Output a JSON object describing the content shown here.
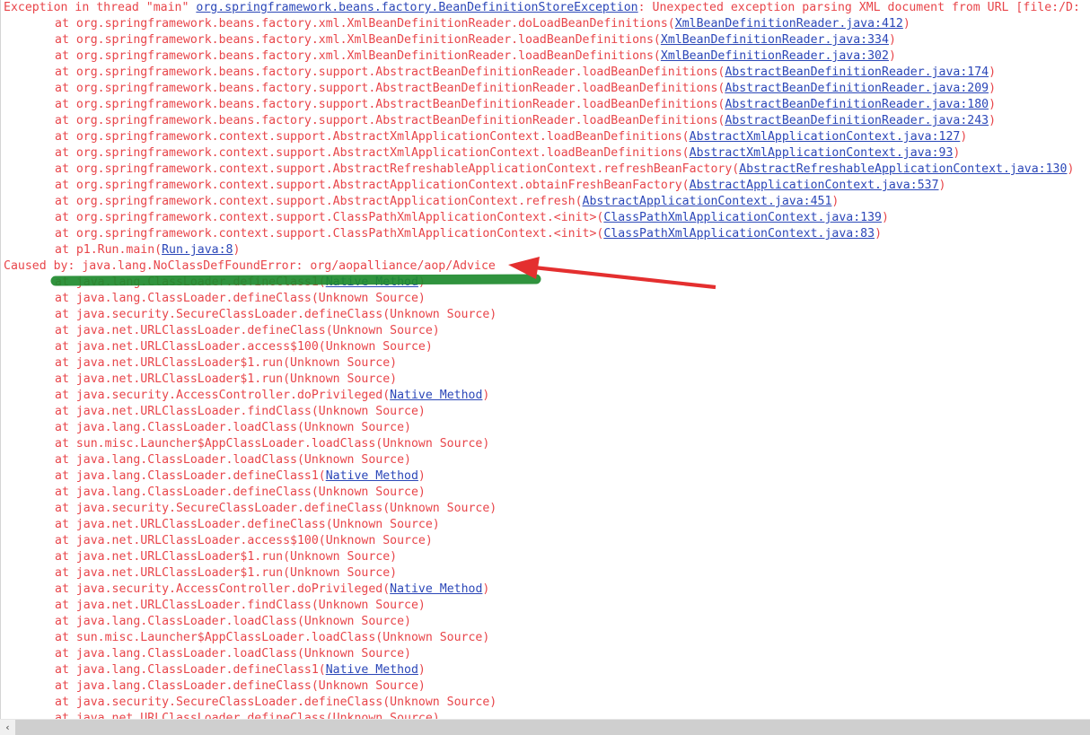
{
  "app": {
    "kind": "java-stacktrace-console",
    "colors": {
      "background": "#ffffff",
      "trace_text": "#e8454a",
      "hyperlink": "#2b47b8",
      "highlighter_green": "#1f8a2e",
      "arrow_red": "#e42f2f",
      "scrollbar_track": "#cfcfcf",
      "scrollbar_button": "#f0f0f0"
    }
  },
  "scrollbar": {
    "left_arrow_glyph": "‹",
    "orientation": "horizontal"
  },
  "annotations": {
    "highlighter": {
      "name": "green-highlighter-stroke",
      "color": "#1f8a2e",
      "target_text": "Caused by: java.lang.NoClassDefFoundError: org/aopalliance/aop/Advice"
    },
    "arrow": {
      "name": "red-arrow",
      "color": "#e42f2f",
      "points_to": "Caused by: java.lang.NoClassDefFoundError: org/aopalliance/aop/Advice"
    }
  },
  "trace": {
    "lines": [
      {
        "indent": false,
        "parts": [
          {
            "t": "Exception in thread \"main\" ",
            "link": false
          },
          {
            "t": "org.springframework.beans.factory.BeanDefinitionStoreException",
            "link": true
          },
          {
            "t": ": Unexpected exception parsing XML document from URL [file:/D:",
            "link": false
          }
        ]
      },
      {
        "indent": true,
        "parts": [
          {
            "t": "at org.springframework.beans.factory.xml.XmlBeanDefinitionReader.doLoadBeanDefinitions(",
            "link": false
          },
          {
            "t": "XmlBeanDefinitionReader.java:412",
            "link": true
          },
          {
            "t": ")",
            "link": false
          }
        ]
      },
      {
        "indent": true,
        "parts": [
          {
            "t": "at org.springframework.beans.factory.xml.XmlBeanDefinitionReader.loadBeanDefinitions(",
            "link": false
          },
          {
            "t": "XmlBeanDefinitionReader.java:334",
            "link": true
          },
          {
            "t": ")",
            "link": false
          }
        ]
      },
      {
        "indent": true,
        "parts": [
          {
            "t": "at org.springframework.beans.factory.xml.XmlBeanDefinitionReader.loadBeanDefinitions(",
            "link": false
          },
          {
            "t": "XmlBeanDefinitionReader.java:302",
            "link": true
          },
          {
            "t": ")",
            "link": false
          }
        ]
      },
      {
        "indent": true,
        "parts": [
          {
            "t": "at org.springframework.beans.factory.support.AbstractBeanDefinitionReader.loadBeanDefinitions(",
            "link": false
          },
          {
            "t": "AbstractBeanDefinitionReader.java:174",
            "link": true
          },
          {
            "t": ")",
            "link": false
          }
        ]
      },
      {
        "indent": true,
        "parts": [
          {
            "t": "at org.springframework.beans.factory.support.AbstractBeanDefinitionReader.loadBeanDefinitions(",
            "link": false
          },
          {
            "t": "AbstractBeanDefinitionReader.java:209",
            "link": true
          },
          {
            "t": ")",
            "link": false
          }
        ]
      },
      {
        "indent": true,
        "parts": [
          {
            "t": "at org.springframework.beans.factory.support.AbstractBeanDefinitionReader.loadBeanDefinitions(",
            "link": false
          },
          {
            "t": "AbstractBeanDefinitionReader.java:180",
            "link": true
          },
          {
            "t": ")",
            "link": false
          }
        ]
      },
      {
        "indent": true,
        "parts": [
          {
            "t": "at org.springframework.beans.factory.support.AbstractBeanDefinitionReader.loadBeanDefinitions(",
            "link": false
          },
          {
            "t": "AbstractBeanDefinitionReader.java:243",
            "link": true
          },
          {
            "t": ")",
            "link": false
          }
        ]
      },
      {
        "indent": true,
        "parts": [
          {
            "t": "at org.springframework.context.support.AbstractXmlApplicationContext.loadBeanDefinitions(",
            "link": false
          },
          {
            "t": "AbstractXmlApplicationContext.java:127",
            "link": true
          },
          {
            "t": ")",
            "link": false
          }
        ]
      },
      {
        "indent": true,
        "parts": [
          {
            "t": "at org.springframework.context.support.AbstractXmlApplicationContext.loadBeanDefinitions(",
            "link": false
          },
          {
            "t": "AbstractXmlApplicationContext.java:93",
            "link": true
          },
          {
            "t": ")",
            "link": false
          }
        ]
      },
      {
        "indent": true,
        "parts": [
          {
            "t": "at org.springframework.context.support.AbstractRefreshableApplicationContext.refreshBeanFactory(",
            "link": false
          },
          {
            "t": "AbstractRefreshableApplicationContext.java:130",
            "link": true
          },
          {
            "t": ")",
            "link": false
          }
        ]
      },
      {
        "indent": true,
        "parts": [
          {
            "t": "at org.springframework.context.support.AbstractApplicationContext.obtainFreshBeanFactory(",
            "link": false
          },
          {
            "t": "AbstractApplicationContext.java:537",
            "link": true
          },
          {
            "t": ")",
            "link": false
          }
        ]
      },
      {
        "indent": true,
        "parts": [
          {
            "t": "at org.springframework.context.support.AbstractApplicationContext.refresh(",
            "link": false
          },
          {
            "t": "AbstractApplicationContext.java:451",
            "link": true
          },
          {
            "t": ")",
            "link": false
          }
        ]
      },
      {
        "indent": true,
        "parts": [
          {
            "t": "at org.springframework.context.support.ClassPathXmlApplicationContext.<init>(",
            "link": false
          },
          {
            "t": "ClassPathXmlApplicationContext.java:139",
            "link": true
          },
          {
            "t": ")",
            "link": false
          }
        ]
      },
      {
        "indent": true,
        "parts": [
          {
            "t": "at org.springframework.context.support.ClassPathXmlApplicationContext.<init>(",
            "link": false
          },
          {
            "t": "ClassPathXmlApplicationContext.java:83",
            "link": true
          },
          {
            "t": ")",
            "link": false
          }
        ]
      },
      {
        "indent": true,
        "parts": [
          {
            "t": "at p1.Run.main(",
            "link": false
          },
          {
            "t": "Run.java:8",
            "link": true
          },
          {
            "t": ")",
            "link": false
          }
        ]
      },
      {
        "indent": false,
        "parts": [
          {
            "t": "Caused by: java.lang.NoClassDefFoundError: org/aopalliance/aop/Advice",
            "link": false
          }
        ]
      },
      {
        "indent": true,
        "parts": [
          {
            "t": "at java.lang.ClassLoader.defineClass1(",
            "link": false
          },
          {
            "t": "Native Method",
            "link": true
          },
          {
            "t": ")",
            "link": false
          }
        ]
      },
      {
        "indent": true,
        "parts": [
          {
            "t": "at java.lang.ClassLoader.defineClass(Unknown Source)",
            "link": false
          }
        ]
      },
      {
        "indent": true,
        "parts": [
          {
            "t": "at java.security.SecureClassLoader.defineClass(Unknown Source)",
            "link": false
          }
        ]
      },
      {
        "indent": true,
        "parts": [
          {
            "t": "at java.net.URLClassLoader.defineClass(Unknown Source)",
            "link": false
          }
        ]
      },
      {
        "indent": true,
        "parts": [
          {
            "t": "at java.net.URLClassLoader.access$100(Unknown Source)",
            "link": false
          }
        ]
      },
      {
        "indent": true,
        "parts": [
          {
            "t": "at java.net.URLClassLoader$1.run(Unknown Source)",
            "link": false
          }
        ]
      },
      {
        "indent": true,
        "parts": [
          {
            "t": "at java.net.URLClassLoader$1.run(Unknown Source)",
            "link": false
          }
        ]
      },
      {
        "indent": true,
        "parts": [
          {
            "t": "at java.security.AccessController.doPrivileged(",
            "link": false
          },
          {
            "t": "Native Method",
            "link": true
          },
          {
            "t": ")",
            "link": false
          }
        ]
      },
      {
        "indent": true,
        "parts": [
          {
            "t": "at java.net.URLClassLoader.findClass(Unknown Source)",
            "link": false
          }
        ]
      },
      {
        "indent": true,
        "parts": [
          {
            "t": "at java.lang.ClassLoader.loadClass(Unknown Source)",
            "link": false
          }
        ]
      },
      {
        "indent": true,
        "parts": [
          {
            "t": "at sun.misc.Launcher$AppClassLoader.loadClass(Unknown Source)",
            "link": false
          }
        ]
      },
      {
        "indent": true,
        "parts": [
          {
            "t": "at java.lang.ClassLoader.loadClass(Unknown Source)",
            "link": false
          }
        ]
      },
      {
        "indent": true,
        "parts": [
          {
            "t": "at java.lang.ClassLoader.defineClass1(",
            "link": false
          },
          {
            "t": "Native Method",
            "link": true
          },
          {
            "t": ")",
            "link": false
          }
        ]
      },
      {
        "indent": true,
        "parts": [
          {
            "t": "at java.lang.ClassLoader.defineClass(Unknown Source)",
            "link": false
          }
        ]
      },
      {
        "indent": true,
        "parts": [
          {
            "t": "at java.security.SecureClassLoader.defineClass(Unknown Source)",
            "link": false
          }
        ]
      },
      {
        "indent": true,
        "parts": [
          {
            "t": "at java.net.URLClassLoader.defineClass(Unknown Source)",
            "link": false
          }
        ]
      },
      {
        "indent": true,
        "parts": [
          {
            "t": "at java.net.URLClassLoader.access$100(Unknown Source)",
            "link": false
          }
        ]
      },
      {
        "indent": true,
        "parts": [
          {
            "t": "at java.net.URLClassLoader$1.run(Unknown Source)",
            "link": false
          }
        ]
      },
      {
        "indent": true,
        "parts": [
          {
            "t": "at java.net.URLClassLoader$1.run(Unknown Source)",
            "link": false
          }
        ]
      },
      {
        "indent": true,
        "parts": [
          {
            "t": "at java.security.AccessController.doPrivileged(",
            "link": false
          },
          {
            "t": "Native Method",
            "link": true
          },
          {
            "t": ")",
            "link": false
          }
        ]
      },
      {
        "indent": true,
        "parts": [
          {
            "t": "at java.net.URLClassLoader.findClass(Unknown Source)",
            "link": false
          }
        ]
      },
      {
        "indent": true,
        "parts": [
          {
            "t": "at java.lang.ClassLoader.loadClass(Unknown Source)",
            "link": false
          }
        ]
      },
      {
        "indent": true,
        "parts": [
          {
            "t": "at sun.misc.Launcher$AppClassLoader.loadClass(Unknown Source)",
            "link": false
          }
        ]
      },
      {
        "indent": true,
        "parts": [
          {
            "t": "at java.lang.ClassLoader.loadClass(Unknown Source)",
            "link": false
          }
        ]
      },
      {
        "indent": true,
        "parts": [
          {
            "t": "at java.lang.ClassLoader.defineClass1(",
            "link": false
          },
          {
            "t": "Native Method",
            "link": true
          },
          {
            "t": ")",
            "link": false
          }
        ]
      },
      {
        "indent": true,
        "parts": [
          {
            "t": "at java.lang.ClassLoader.defineClass(Unknown Source)",
            "link": false
          }
        ]
      },
      {
        "indent": true,
        "parts": [
          {
            "t": "at java.security.SecureClassLoader.defineClass(Unknown Source)",
            "link": false
          }
        ]
      },
      {
        "indent": true,
        "parts": [
          {
            "t": "at java.net.URLClassLoader.defineClass(Unknown Source)",
            "link": false
          }
        ]
      }
    ]
  }
}
